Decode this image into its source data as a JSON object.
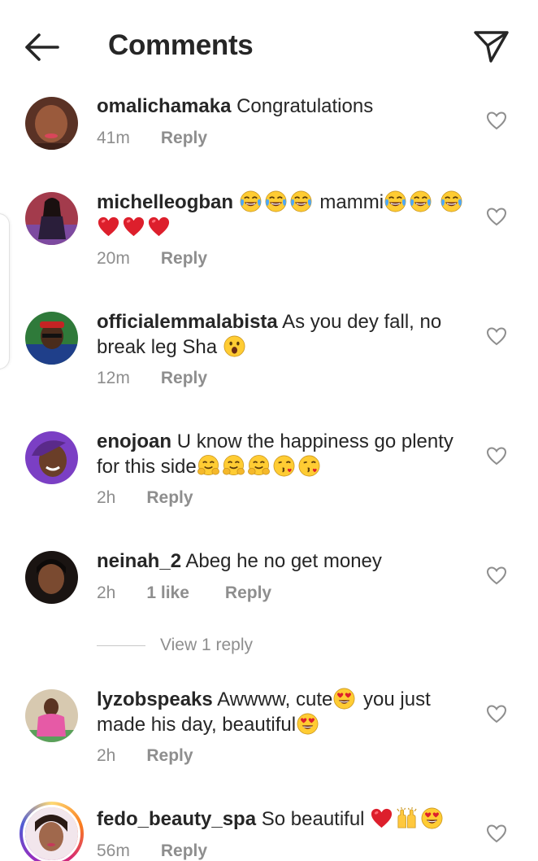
{
  "header": {
    "title": "Comments",
    "back_icon": "arrow-left-icon",
    "share_icon": "paper-plane-icon"
  },
  "colors": {
    "text": "#262626",
    "muted": "#8e8e8e",
    "heart_like": "#e0245e"
  },
  "comments": [
    {
      "username": "omalichamaka",
      "text": "Congratulations",
      "emojis": [],
      "time": "41m",
      "likes": "",
      "reply": "Reply"
    },
    {
      "username": "michelleogban",
      "text_before": "",
      "emojis_before": [
        "face-with-tears-of-joy",
        "face-with-tears-of-joy",
        "face-with-tears-of-joy"
      ],
      "text": "mammi",
      "emojis": [
        "face-with-tears-of-joy",
        "face-with-tears-of-joy",
        "face-with-tears-of-joy",
        "red-heart",
        "red-heart",
        "red-heart"
      ],
      "time": "20m",
      "likes": "",
      "reply": "Reply"
    },
    {
      "username": "officialemmalabista",
      "text": "As you dey fall, no break leg Sha",
      "emojis": [
        "face-with-open-mouth"
      ],
      "time": "12m",
      "likes": "",
      "reply": "Reply"
    },
    {
      "username": "enojoan",
      "text": "U know the happiness go plenty for this side",
      "emojis": [
        "hugging-face",
        "hugging-face",
        "hugging-face",
        "face-blowing-kiss",
        "face-blowing-kiss"
      ],
      "time": "2h",
      "likes": "",
      "reply": "Reply"
    },
    {
      "username": "neinah_2",
      "text": "Abeg he no get money",
      "emojis": [],
      "time": "2h",
      "likes": "1 like",
      "reply": "Reply"
    },
    {
      "username": "lyzobspeaks",
      "text": "Awwww, cute",
      "text_after": "you just made his day, beautiful",
      "emojis": [
        "smiling-face-with-heart-eyes",
        "smiling-face-with-heart-eyes"
      ],
      "time": "2h",
      "likes": "",
      "reply": "Reply"
    },
    {
      "username": "fedo_beauty_spa",
      "text": "So beautiful",
      "emojis": [
        "red-heart",
        "raising-hands",
        "smiling-face-with-heart-eyes"
      ],
      "time": "56m",
      "likes": "",
      "reply": "Reply"
    }
  ],
  "view_replies": "View 1 reply"
}
